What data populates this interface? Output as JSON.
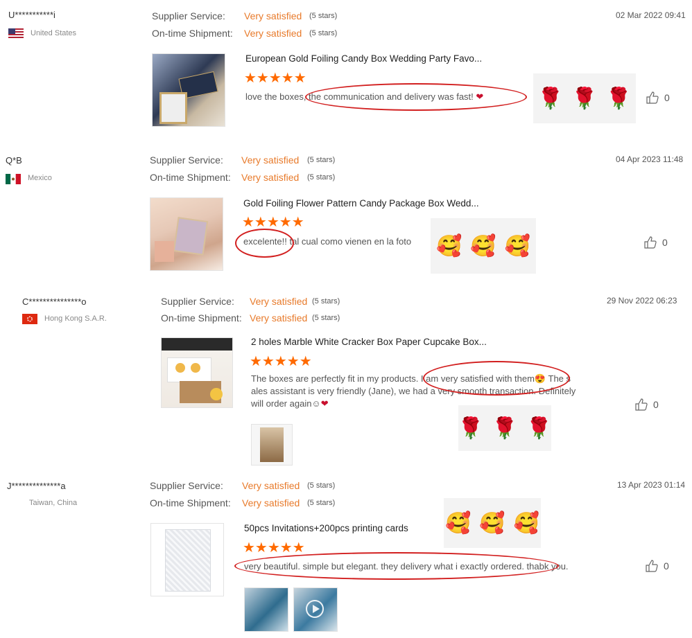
{
  "labels": {
    "service": "Supplier Service:",
    "shipment": "On-time Shipment:"
  },
  "reviews": [
    {
      "user": "U***********i",
      "country": "United States",
      "date": "02 Mar 2022 09:41",
      "service": "Very satisfied",
      "service_stars": "(5 stars)",
      "shipment": "Very satisfied",
      "shipment_stars": "(5 stars)",
      "product": "European Gold Foiling Candy Box Wedding Party Favo...",
      "text": "love the boxes, the communication and delivery was fast!",
      "emojis": [
        "🌹",
        "🌹",
        "🌹"
      ],
      "likes": "0"
    },
    {
      "user": "Q*B",
      "country": "Mexico",
      "date": "04 Apr 2023 11:48",
      "service": "Very satisfied",
      "service_stars": "(5 stars)",
      "shipment": "Very satisfied",
      "shipment_stars": "(5 stars)",
      "product": "Gold Foiling Flower Pattern Candy Package Box Wedd...",
      "text": "excelente!! tal cual como vienen en la foto",
      "emojis": [
        "🥰",
        "🥰",
        "🥰"
      ],
      "likes": "0"
    },
    {
      "user": "C***************o",
      "country": "Hong Kong S.A.R.",
      "date": "29 Nov 2022 06:23",
      "service": "Very satisfied",
      "service_stars": "(5 stars)",
      "shipment": "Very satisfied",
      "shipment_stars": "(5 stars)",
      "product": "2 holes Marble White Cracker Box Paper Cupcake Box...",
      "text_lines": [
        "The boxes are perfectly fit in my products. I am very satisfied with them😍 The s",
        "ales assistant is very friendly (Jane), we had a very smooth transaction. Definitely",
        "will order again☺"
      ],
      "emojis": [
        "🌹",
        "🌹",
        "🌹"
      ],
      "likes": "0"
    },
    {
      "user": "J**************a",
      "country": "Taiwan, China",
      "date": "13 Apr 2023 01:14",
      "service": "Very satisfied",
      "service_stars": "(5 stars)",
      "shipment": "Very satisfied",
      "shipment_stars": "(5 stars)",
      "product": "50pcs Invitations+200pcs printing cards",
      "text": "very beautiful. simple but elegant. they delivery what i exactly ordered. thabk you.",
      "emojis": [
        "🥰",
        "🥰",
        "🥰"
      ],
      "likes": "0"
    }
  ],
  "stars": "★★★★★",
  "heart": "❤",
  "colors": {
    "accent": "#e87a2a",
    "star": "#ff6a00",
    "annotation": "#d21f1f"
  }
}
